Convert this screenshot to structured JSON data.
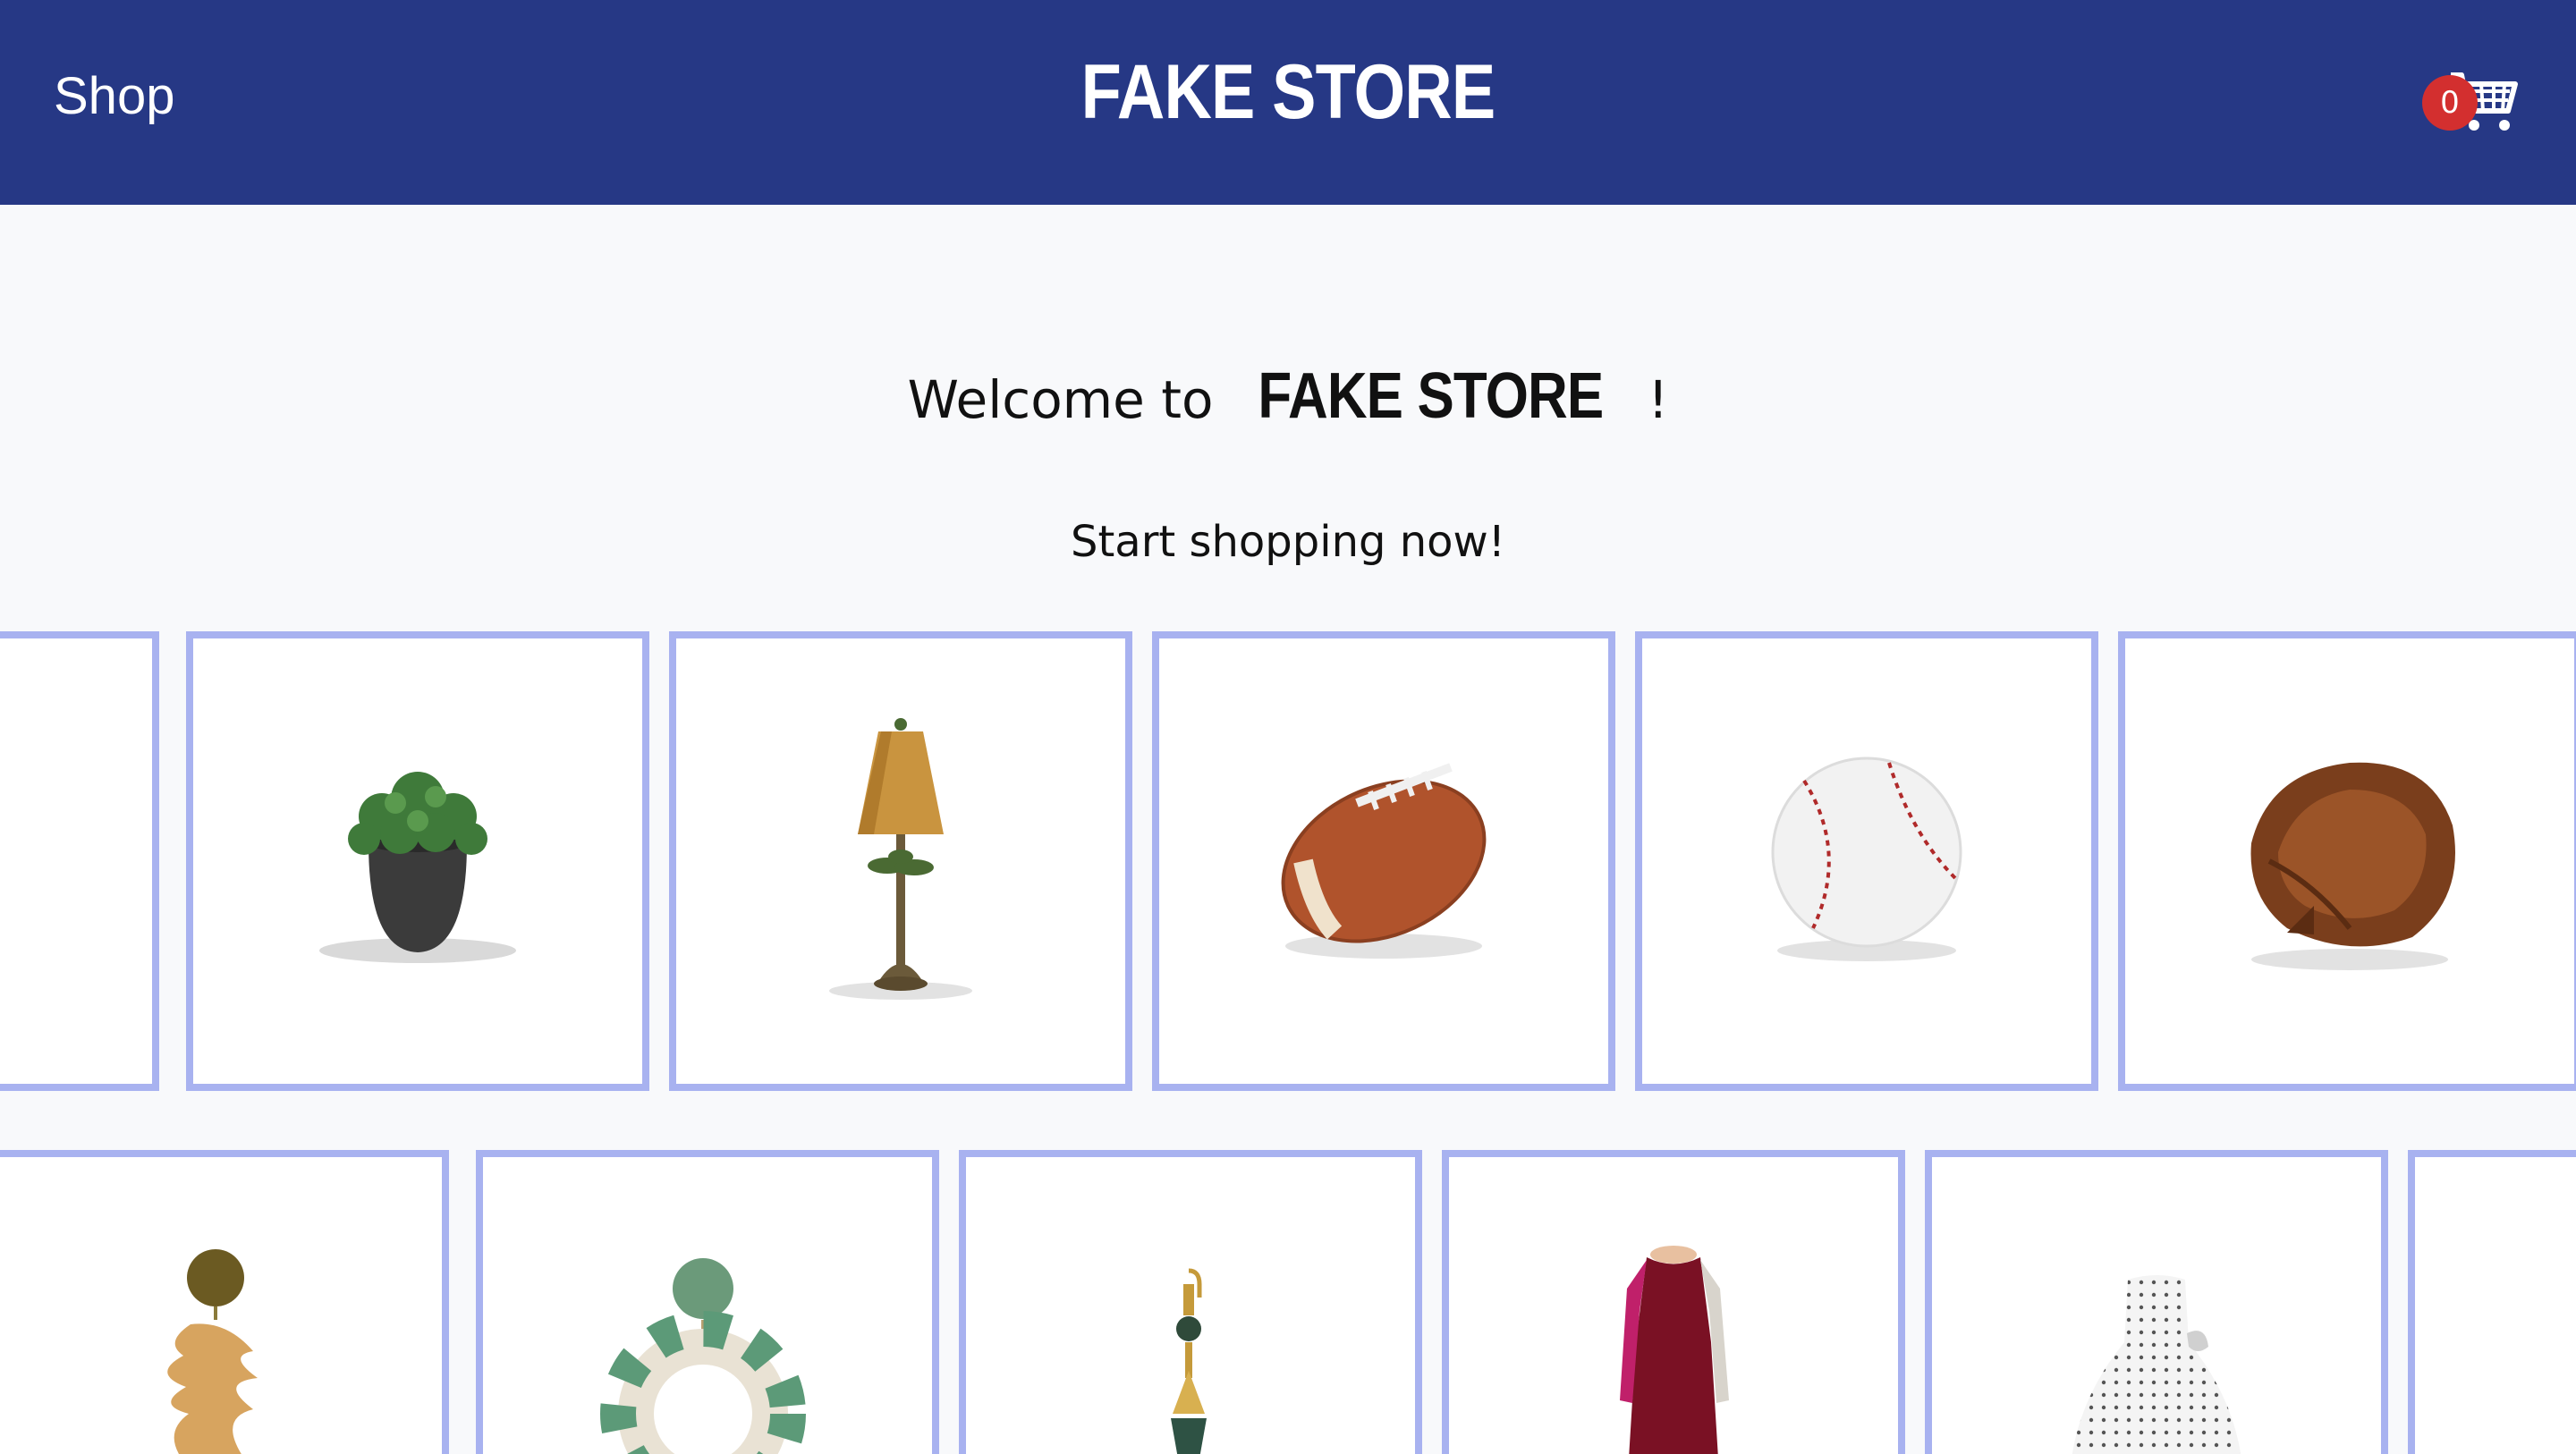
{
  "header": {
    "shop_label": "Shop",
    "brand": "FAKE STORE",
    "cart_count": "0",
    "cart_icon": "cart-icon",
    "background_color": "#263885",
    "badge_color": "#d32f2f"
  },
  "hero": {
    "welcome_prefix": "Welcome to ",
    "welcome_brand": "FAKE STORE",
    "welcome_suffix": " !",
    "subtitle": "Start shopping now!"
  },
  "card_border_color": "#a8b2f0",
  "products_row1": [
    {
      "name": "partial-product-image"
    },
    {
      "name": "potted-plant-image"
    },
    {
      "name": "palm-table-lamp-image"
    },
    {
      "name": "american-football-image"
    },
    {
      "name": "baseball-image"
    },
    {
      "name": "baseball-glove-image"
    }
  ],
  "products_row2": [
    {
      "name": "leaf-earring-image"
    },
    {
      "name": "checkered-hoop-earring-image"
    },
    {
      "name": "drop-earring-image"
    },
    {
      "name": "maroon-dress-image"
    },
    {
      "name": "polka-dot-dress-image"
    },
    {
      "name": "partial-product-image"
    }
  ]
}
